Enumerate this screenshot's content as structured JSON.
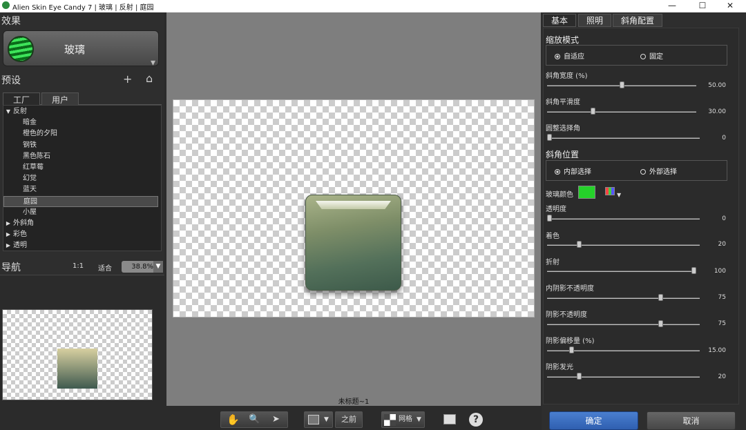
{
  "window": {
    "title": "Alien Skin Eye Candy 7 | 玻璃 | 反射 | 庭园",
    "min": "—",
    "max": "☐",
    "close": "✕"
  },
  "left": {
    "effects_heading": "效果",
    "effect_name": "玻璃",
    "presets_heading": "预设",
    "add": "+",
    "home": "⌂",
    "tabs": [
      "工厂",
      "用户"
    ],
    "tree": [
      {
        "label": "反射",
        "type": "group",
        "open": true
      },
      {
        "label": "暗金",
        "type": "item"
      },
      {
        "label": "橙色的夕阳",
        "type": "item"
      },
      {
        "label": "钢铁",
        "type": "item"
      },
      {
        "label": "黑色陈石",
        "type": "item"
      },
      {
        "label": "红草莓",
        "type": "item"
      },
      {
        "label": "幻觉",
        "type": "item"
      },
      {
        "label": "蓝天",
        "type": "item"
      },
      {
        "label": "庭园",
        "type": "item",
        "selected": true
      },
      {
        "label": "小屋",
        "type": "item"
      },
      {
        "label": "外斜角",
        "type": "group",
        "open": false
      },
      {
        "label": "彩色",
        "type": "group",
        "open": false
      },
      {
        "label": "透明",
        "type": "group",
        "open": false
      }
    ],
    "nav_heading": "导航",
    "nav_1to1": "1:1",
    "nav_fit": "适合",
    "zoom": "38.8%"
  },
  "center": {
    "doc_name": "未标题~1",
    "before": "之前",
    "grid": "网格",
    "help": "?"
  },
  "right": {
    "tabs": [
      "基本",
      "照明",
      "斜角配置"
    ],
    "scale_mode": {
      "label": "缩放模式",
      "options": [
        "自适应",
        "固定"
      ],
      "selected": 0
    },
    "bevel_width": {
      "label": "斜角宽度 (%)",
      "value": "50.00",
      "frac": 0.5
    },
    "bevel_smooth": {
      "label": "斜角平滑度",
      "value": "30.00",
      "frac": 0.3
    },
    "round_corners": {
      "label": "圆整选择角",
      "value": "0",
      "frac": 0
    },
    "bevel_pos": {
      "label": "斜角位置",
      "options": [
        "内部选择",
        "外部选择"
      ],
      "selected": 0
    },
    "glass_color": {
      "label": "玻璃颜色",
      "value": "#25d12a"
    },
    "opacity": {
      "label": "透明度",
      "value": "0",
      "frac": 0
    },
    "tint": {
      "label": "着色",
      "value": "20",
      "frac": 0.2
    },
    "refraction": {
      "label": "折射",
      "value": "100",
      "frac": 1
    },
    "inner_shadow": {
      "label": "内阴影不透明度",
      "value": "75",
      "frac": 0.75
    },
    "shadow_opacity": {
      "label": "阴影不透明度",
      "value": "75",
      "frac": 0.75
    },
    "shadow_offset": {
      "label": "阴影偏移量 (%)",
      "value": "15.00",
      "frac": 0.15
    },
    "shadow_glow": {
      "label": "阴影发光",
      "value": "20",
      "frac": 0.2
    },
    "ok": "确定",
    "cancel": "取消"
  }
}
